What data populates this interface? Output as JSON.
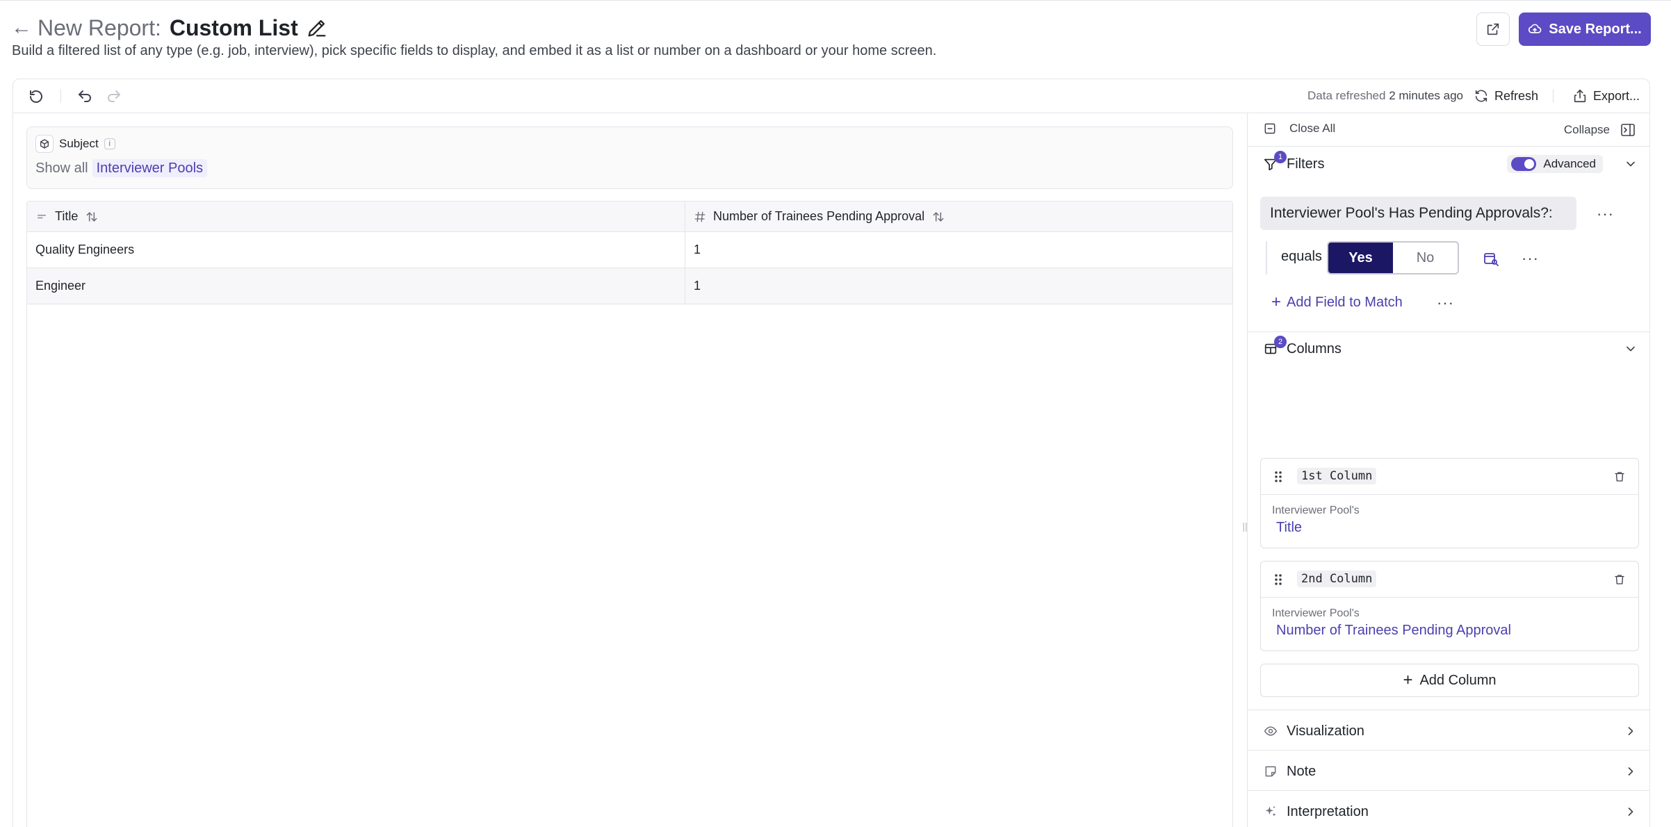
{
  "header": {
    "prefix": "New Report:",
    "title": "Custom List",
    "subtitle": "Build a filtered list of any type (e.g. job, interview), pick specific fields to display, and embed it as a list or number on a dashboard or your home screen.",
    "save_label": "Save Report..."
  },
  "toolbar": {
    "refresh_info_prefix": "Data refreshed",
    "refresh_info_time": "2 minutes ago",
    "refresh_label": "Refresh",
    "export_label": "Export..."
  },
  "subject": {
    "label": "Subject",
    "info": "i",
    "show_all": "Show all",
    "entity": "Interviewer Pools"
  },
  "table": {
    "columns": [
      "Title",
      "Number of Trainees Pending Approval"
    ],
    "rows": [
      [
        "Quality Engineers",
        "1"
      ],
      [
        "Engineer",
        "1"
      ]
    ]
  },
  "panel": {
    "close_all": "Close All",
    "collapse": "Collapse",
    "filters": {
      "label": "Filters",
      "count": "1",
      "advanced_label": "Advanced",
      "advanced_on": true,
      "field": "Interviewer Pool's Has Pending Approvals?:",
      "operator": "equals",
      "yes": "Yes",
      "no": "No",
      "selected": "Yes",
      "add_match": "Add Field to Match"
    },
    "columns": {
      "label": "Columns",
      "count": "2",
      "items": [
        {
          "name": "1st Column",
          "source": "Interviewer Pool's",
          "field": "Title"
        },
        {
          "name": "2nd Column",
          "source": "Interviewer Pool's",
          "field": "Number of Trainees Pending Approval"
        }
      ],
      "add_label": "Add Column"
    },
    "sections": [
      {
        "label": "Visualization",
        "icon": "eye-icon"
      },
      {
        "label": "Note",
        "icon": "note-icon"
      },
      {
        "label": "Interpretation",
        "icon": "sparkle-icon"
      }
    ]
  },
  "colors": {
    "accent": "#5b4bc4",
    "link": "#4a3fb0",
    "selected": "#1c1764"
  }
}
